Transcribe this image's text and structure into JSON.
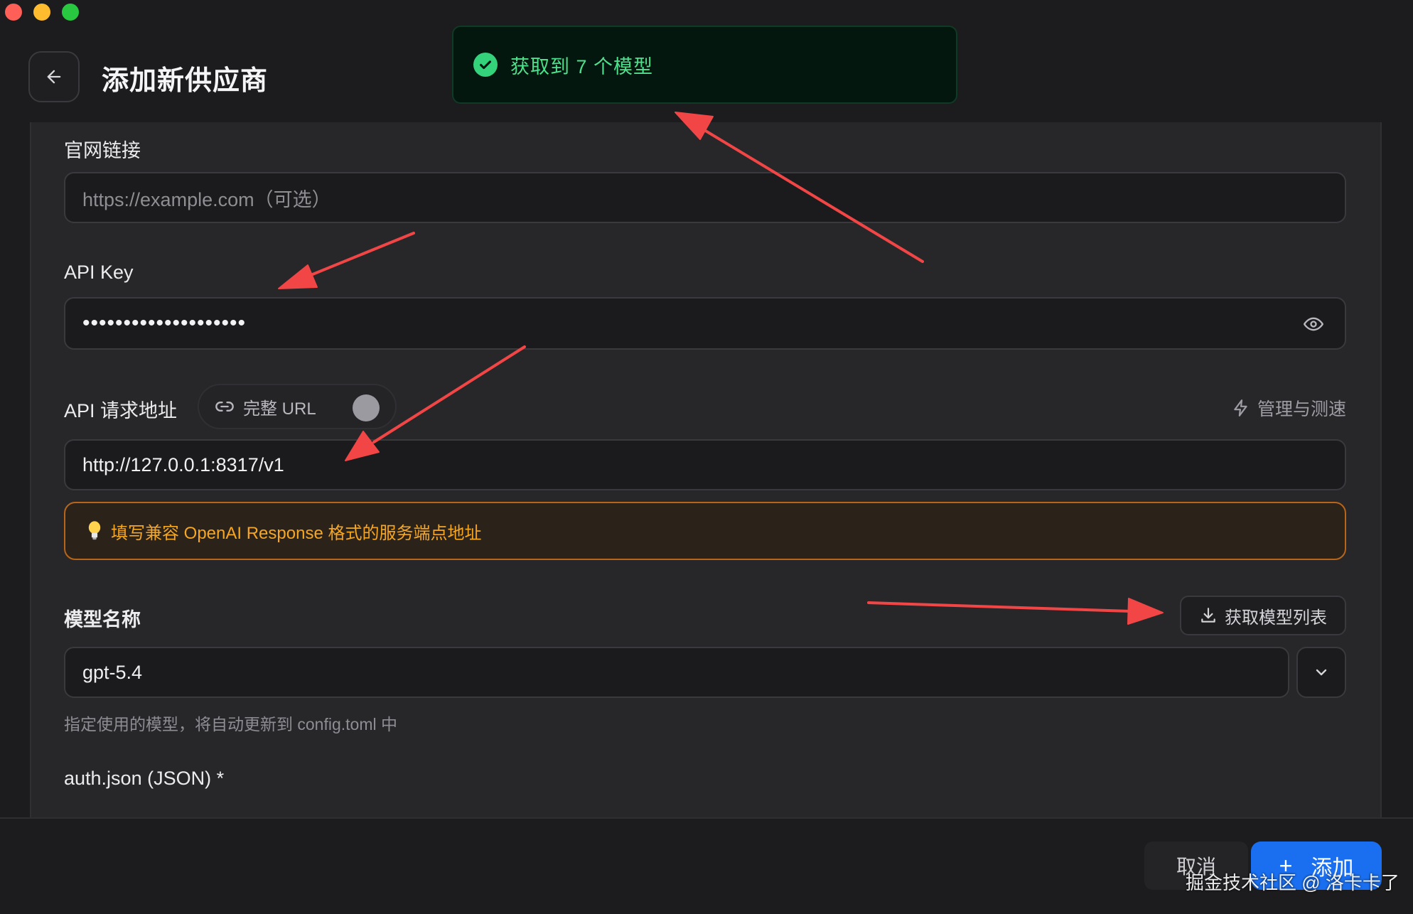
{
  "header": {
    "title": "添加新供应商"
  },
  "toast": {
    "text": "获取到 7 个模型"
  },
  "fields": {
    "website": {
      "label": "官网链接",
      "placeholder": "https://example.com（可选）"
    },
    "api_key": {
      "label": "API Key",
      "masked_value": "••••••••••••••••••••"
    },
    "api_url": {
      "label": "API 请求地址",
      "full_url_toggle_label": "完整 URL",
      "manage_label": "管理与测速",
      "value": "http://127.0.0.1:8317/v1",
      "hint": "填写兼容 OpenAI Response 格式的服务端点地址"
    },
    "model": {
      "label": "模型名称",
      "fetch_button": "获取模型列表",
      "value": "gpt-5.4",
      "helper": "指定使用的模型，将自动更新到 config.toml 中"
    },
    "auth_json": {
      "label": "auth.json (JSON) *"
    }
  },
  "footer": {
    "cancel_label": "取消",
    "add_label": "添加",
    "add_icon": "+"
  },
  "watermark": "掘金技术社区 @ 洛卡卡了",
  "colors": {
    "accent": "#1a6ff0",
    "success": "#34d27b",
    "warning": "#f5a623",
    "annotation": "#f24646"
  }
}
